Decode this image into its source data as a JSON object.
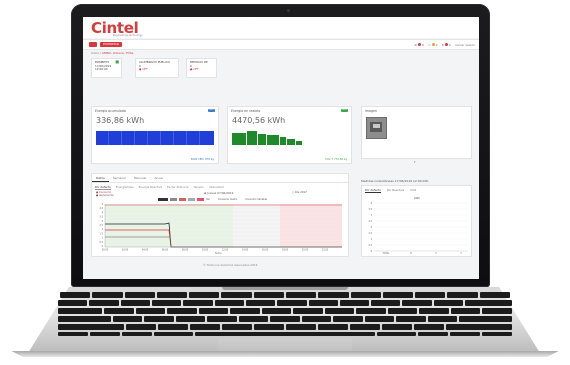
{
  "app": {
    "brand": "Cintel",
    "tagline": "Engineering technology",
    "export_label": "EXPORTAR",
    "alert_counts": {
      "red": "8",
      "amber": "0",
      "bell": "0"
    },
    "user_label": "Cerrar sesión",
    "breadcrumb": [
      "Inicio",
      "AMBO, Urbana, TDSe"
    ],
    "footer": "© Todos los derechos reservados 2019"
  },
  "sites": [
    {
      "name": "BOMBEO5",
      "line2": "17/06/2019",
      "line3": "12:00:00",
      "status": ""
    },
    {
      "name": "ALUMBRADO PÚBLICO",
      "line2": "0",
      "line3": "",
      "status": "OFF"
    },
    {
      "name": "MEDIDAS DE",
      "line2": "0",
      "line3": "",
      "status": "OFF"
    }
  ],
  "energy_acc": {
    "title": "Energía acumulada",
    "value": "336,86 kWh",
    "badge": "MES",
    "sub": "3020 VED, 076 kg"
  },
  "energy_out": {
    "title": "Energía en realoto",
    "value": "4470,56 kWh",
    "badge": "MES",
    "sub": "CO2 7 770,56 kg"
  },
  "image_panel": {
    "title": "Imagen"
  },
  "main_tabs": [
    "Datos",
    "Semanal",
    "Mensual",
    "Anual"
  ],
  "sub_tabs": [
    "Por defecto",
    "Energía/Días",
    "Energía Reactiva",
    "Factor Potencia",
    "Tensión",
    "Intensidad"
  ],
  "filters": {
    "date_label": "Jueves 07/06/2019",
    "legend_a": "Consumo",
    "legend_b": "Generación",
    "btn_labels": [
      "Ver",
      "Consumo medio",
      "Consumo Variable"
    ],
    "right_opt": "Día 2017"
  },
  "chart_y_ticks": [
    "5",
    "4.5",
    "4",
    "3.5",
    "3",
    "2.5",
    "2",
    "1.5",
    "1",
    "0.5",
    "0"
  ],
  "chart_x_ticks": [
    "00:00",
    "02:00",
    "04:00",
    "06:00",
    "08:00",
    "10:00",
    "12:00",
    "14:00",
    "16:00",
    "18:00",
    "20:00",
    "22:00"
  ],
  "chart_x_label": "Fecha",
  "right_panel": {
    "title": "Medidas instantáneas 17/06/2019 12:00:00h",
    "tabs": [
      "Por defecto",
      "Por Reactiva",
      "CO2"
    ],
    "chart_title": "kWh",
    "y_ticks": [
      "4",
      "3.5",
      "3",
      "2.5",
      "2",
      "1.5",
      "1",
      "0.5",
      "0"
    ],
    "x_ticks": [
      "TOTAL",
      "R",
      "S",
      "T"
    ]
  }
}
